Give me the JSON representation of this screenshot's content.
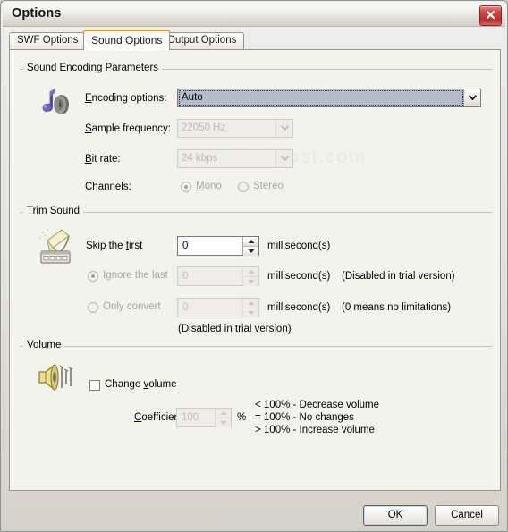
{
  "window": {
    "title": "Options",
    "close_icon": "close-icon"
  },
  "tabs": [
    {
      "label": "SWF Options",
      "active": false
    },
    {
      "label": "Sound Options",
      "active": true
    },
    {
      "label": "Output Options",
      "active": false
    }
  ],
  "watermark": "soft4boost.com",
  "sound_encoding": {
    "group_label": "Sound Encoding Parameters",
    "icon": "music-note-speaker-icon",
    "encoding_options": {
      "label_pre": "E",
      "label_rest": "ncoding options:",
      "value": "Auto",
      "enabled": true
    },
    "sample_frequency": {
      "label_pre": "S",
      "label_rest": "ample frequency:",
      "value": "22050 Hz",
      "enabled": false
    },
    "bit_rate": {
      "label_pre": "B",
      "label_rest": "it rate:",
      "value": "24 kbps",
      "enabled": false
    },
    "channels": {
      "label": "Channels:",
      "mono": {
        "label_pre": "M",
        "label_rest": "ono",
        "selected": true,
        "enabled": false
      },
      "stereo": {
        "label_pre": "S",
        "label_rest": "tereo",
        "selected": false,
        "enabled": false
      }
    }
  },
  "trim_sound": {
    "group_label": "Trim Sound",
    "icon": "gramophone-icon",
    "skip_first": {
      "label_pre": "Skip the ",
      "label_key": "f",
      "label_rest": "irst",
      "value": "0",
      "unit": "millisecond(s)",
      "enabled": true
    },
    "ignore_last": {
      "label": "Ignore the last",
      "value": "0",
      "unit": "millisecond(s)",
      "hint": "(Disabled in trial version)",
      "selected": true,
      "enabled": false
    },
    "only_convert": {
      "label": "Only convert",
      "value": "0",
      "unit": "millisecond(s)",
      "hint": "(0 means no limitations)",
      "hint2": "(Disabled in trial version)",
      "selected": false,
      "enabled": false
    }
  },
  "volume": {
    "group_label": "Volume",
    "icon": "speaker-waves-icon",
    "change_volume": {
      "label_pre": "Change ",
      "label_key": "v",
      "label_rest": "olume",
      "checked": false
    },
    "coefficient": {
      "label_pre": "C",
      "label_rest": "oefficient:",
      "value": "100",
      "unit": "%",
      "enabled": false
    },
    "legend": [
      "< 100% - Decrease volume",
      "= 100% - No changes",
      "> 100% - Increase volume"
    ]
  },
  "footer": {
    "ok_label": "OK",
    "cancel_label": "Cancel"
  }
}
